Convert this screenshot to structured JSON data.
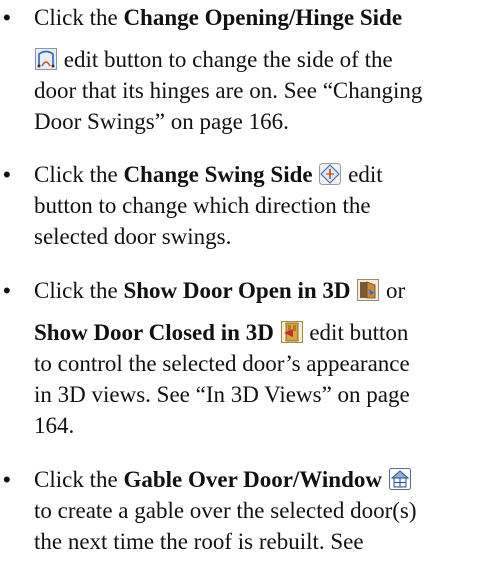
{
  "bullet_char": "•",
  "items": [
    {
      "lines": [
        {
          "pre": "Click the ",
          "bold": "Change Opening/Hinge Side"
        },
        {
          "post": " edit button to change the side of the"
        },
        {
          "text": "door that its hinges are on. See “Changing"
        },
        {
          "text": "Door Swings” on page 166."
        }
      ],
      "icon": "change-opening-hinge-side-icon"
    },
    {
      "lines": [
        {
          "pre": "Click the ",
          "bold": "Change Swing Side",
          "post": " edit"
        },
        {
          "text": "button to change which direction the"
        },
        {
          "text": "selected door swings."
        }
      ],
      "icon": "change-swing-side-icon"
    },
    {
      "lines": [
        {
          "pre": "Click the ",
          "bold": "Show Door Open in 3D",
          "post": " or"
        },
        {
          "bold": "Show Door Closed in 3D",
          "post": " edit button"
        },
        {
          "text": "to control the selected door’s appearance"
        },
        {
          "text": "in 3D views. See “In 3D Views” on page"
        },
        {
          "text": "164."
        }
      ],
      "icons": [
        "show-door-open-in-3d-icon",
        "show-door-closed-in-3d-icon"
      ]
    },
    {
      "lines": [
        {
          "pre": "Click the ",
          "bold": "Gable Over Door/Window"
        },
        {
          "text": "to create a gable over the selected door(s)"
        },
        {
          "text": "the next time the roof is rebuilt. See"
        }
      ],
      "icon": "gable-over-door-window-icon"
    }
  ]
}
